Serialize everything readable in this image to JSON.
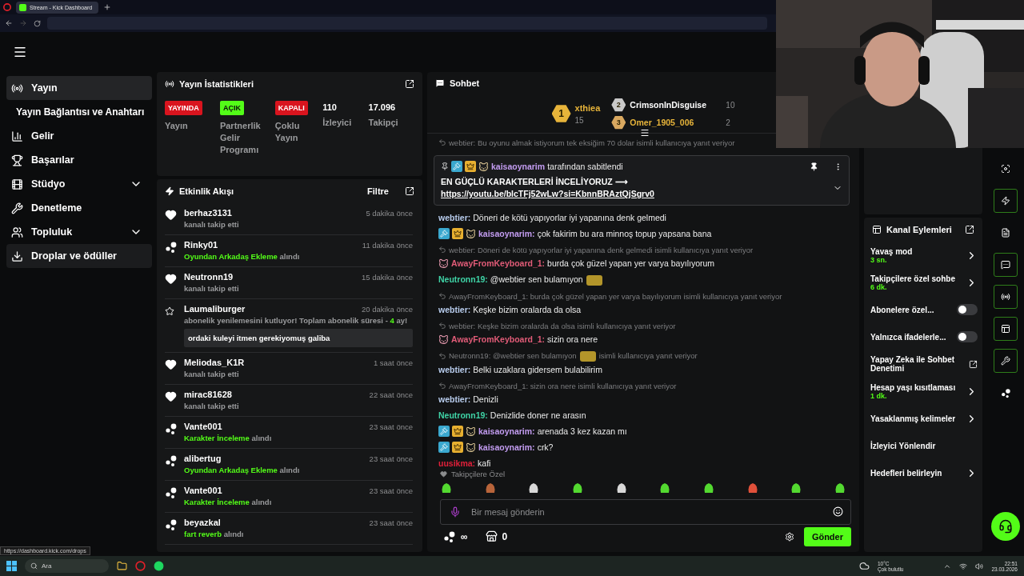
{
  "browser": {
    "tab_title": "Stream - Kick Dashboard",
    "status_url": "https://dashboard.kick.com/drops"
  },
  "sidebar": {
    "items": [
      {
        "label": "Yayın",
        "selected": true,
        "hovered": false,
        "expandable": false
      },
      {
        "label": "Yayın Bağlantısı ve Anahtarı",
        "selected": false,
        "hovered": false,
        "expandable": false
      },
      {
        "label": "Gelir",
        "selected": false,
        "hovered": false,
        "expandable": false
      },
      {
        "label": "Başarılar",
        "selected": false,
        "hovered": false,
        "expandable": false
      },
      {
        "label": "Stüdyo",
        "selected": false,
        "hovered": false,
        "expandable": true
      },
      {
        "label": "Denetleme",
        "selected": false,
        "hovered": false,
        "expandable": false
      },
      {
        "label": "Topluluk",
        "selected": false,
        "hovered": false,
        "expandable": true
      },
      {
        "label": "Droplar ve ödüller",
        "selected": false,
        "hovered": true,
        "expandable": false
      }
    ]
  },
  "stats": {
    "title": "Yayın İstatistikleri",
    "statuses": [
      {
        "badge": "YAYINDA",
        "label": "Yayın",
        "color": "#d9141e"
      },
      {
        "badge": "AÇIK",
        "label": "Partnerlik Gelir Programı",
        "color": "#53fc18"
      },
      {
        "badge": "KAPALI",
        "label": "Çoklu Yayın",
        "color": "#d9141e"
      }
    ],
    "counters": [
      {
        "value": "110",
        "label": "İzleyici"
      },
      {
        "value": "17.096",
        "label": "Takipçi"
      }
    ]
  },
  "activity": {
    "title": "Etkinlik Akışı",
    "filter": "Filtre",
    "items": [
      {
        "kind": "follow",
        "user": "berhaz3131",
        "time": "5 dakika önce",
        "action": "kanalı takip etti"
      },
      {
        "kind": "reward",
        "user": "Rinky01",
        "time": "11 dakika önce",
        "reward": "Oyundan Arkadaş Ekleme",
        "action": "alındı"
      },
      {
        "kind": "follow",
        "user": "Neutronn19",
        "time": "15 dakika önce",
        "action": "kanalı takip etti"
      },
      {
        "kind": "subscription",
        "user": "Laumaliburger",
        "time": "20 dakika önce",
        "action": "abonelik yenilemesini kutluyor! Toplam abonelik süresi -",
        "months": "4",
        "unit": "ay!",
        "quote": "ordaki kuleyi itmen gerekiyomuş galiba"
      },
      {
        "kind": "follow",
        "user": "Meliodas_K1R",
        "time": "1 saat önce",
        "action": "kanalı takip etti"
      },
      {
        "kind": "follow",
        "user": "mirac81628",
        "time": "22 saat önce",
        "action": "kanalı takip etti"
      },
      {
        "kind": "reward",
        "user": "Vante001",
        "time": "23 saat önce",
        "reward": "Karakter İnceleme",
        "action": "alındı"
      },
      {
        "kind": "reward",
        "user": "alibertug",
        "time": "23 saat önce",
        "reward": "Oyundan Arkadaş Ekleme",
        "action": "alındı"
      },
      {
        "kind": "reward",
        "user": "Vante001",
        "time": "23 saat önce",
        "reward": "Karakter İnceleme",
        "action": "alındı"
      },
      {
        "kind": "reward",
        "user": "beyazkal",
        "time": "23 saat önce",
        "reward": "fart reverb",
        "action": "alındı"
      }
    ]
  },
  "chat": {
    "title": "Sohbet",
    "leaderboard": [
      {
        "rank": "1",
        "user": "xthiea",
        "count": "15",
        "color": "#e7b43a"
      },
      {
        "rank": "2",
        "user": "CrimsonInDisguise",
        "count": "10",
        "color": "#ffffff"
      },
      {
        "rank": "3",
        "user": "Omer_1905_006",
        "count": "2",
        "color": "#e7b43a"
      }
    ],
    "messages_above_pin": [
      {
        "reply": "webtier: Bu oyunu almak istiyorum tek eksiğim 70 dolar isimli kullanıcıya yanıt veriyor"
      }
    ],
    "pinned": {
      "badges": [
        {
          "kind": "moderator"
        },
        {
          "kind": "crown"
        },
        {
          "kind": "subscriber"
        }
      ],
      "user": "kaisaoynarim",
      "by": "tarafından sabitlendi",
      "text": "EN GÜÇLÜ KARAKTERLERİ İNCELİYORUZ ⟶",
      "link": "https://youtu.be/blcTFj52wLw?si=KbnnBRAztQjSgrv0"
    },
    "messages": [
      {
        "user": "webtier:",
        "color": "#b9cdee",
        "text": "Döneri de kötü yapıyorlar iyi yapanına denk gelmedi"
      },
      {
        "user": "kaisaoynarim:",
        "color": "#c49df2",
        "badges": [
          {
            "kind": "moderator"
          },
          {
            "kind": "crown"
          },
          {
            "kind": "subscriber"
          }
        ],
        "text": "çok fakirim bu ara minnoş topup yapsana bana"
      },
      {
        "reply": "webtier: Döneri de kötü yapıyorlar iyi yapanına denk gelmedi isimli kullanıcıya yanıt veriyor",
        "user": "AwayFromKeyboard_1:",
        "color": "#e25c78",
        "badges": [
          {
            "kind": "pet"
          }
        ],
        "text": "burda çok güzel yapan yer varya bayılıyorum"
      },
      {
        "user": "Neutronn19:",
        "color": "#3fd3a6",
        "text": "@webtier sen bulamıyon",
        "emote": true
      },
      {
        "reply": "AwayFromKeyboard_1: burda çok güzel yapan yer varya bayılıyorum isimli kullanıcıya yanıt veriyor",
        "user": "webtier:",
        "color": "#b9cdee",
        "text": "Keşke bizim oralarda da olsa"
      },
      {
        "reply": "webtier: Keşke bizim oralarda da olsa isimli kullanıcıya yanıt veriyor",
        "user": "AwayFromKeyboard_1:",
        "color": "#e25c78",
        "badges": [
          {
            "kind": "pet"
          }
        ],
        "text": "sizin ora nere"
      },
      {
        "reply": "Neutronn19: @webtier sen bulamıyon",
        "reply_emote": true,
        "reply_after": "isimli kullanıcıya yanıt veriyor",
        "user": "webtier:",
        "color": "#b9cdee",
        "text": "Belki uzaklara gidersem bulabilirim"
      },
      {
        "reply": "AwayFromKeyboard_1: sizin ora nere isimli kullanıcıya yanıt veriyor",
        "user": "webtier:",
        "color": "#b9cdee",
        "text": "Denizli"
      },
      {
        "user": "Neutronn19:",
        "color": "#3fd3a6",
        "text": "Denizlide doner ne arasın"
      },
      {
        "user": "kaisaoynarim:",
        "color": "#c49df2",
        "badges": [
          {
            "kind": "moderator"
          },
          {
            "kind": "crown"
          },
          {
            "kind": "subscriber"
          }
        ],
        "text": "arenada 3 kez kazan mı"
      },
      {
        "user": "kaisaoynarim:",
        "color": "#c49df2",
        "badges": [
          {
            "kind": "moderator"
          },
          {
            "kind": "crown"
          },
          {
            "kind": "subscriber"
          }
        ],
        "text": "crk?"
      },
      {
        "user": "uusikma:",
        "color": "#e0203a",
        "text": "kafi"
      }
    ],
    "emote_section": "Takipçilere Özel",
    "placeholder": "Bir mesaj gönderin",
    "points": "∞",
    "store_count": "0",
    "send": "Gönder"
  },
  "channel_actions": {
    "title": "Kanal Eylemleri",
    "items": [
      {
        "kind": "nav",
        "label": "Yavaş mod",
        "value": "3 sn."
      },
      {
        "kind": "nav",
        "label": "Takipçilere özel sohbe",
        "value": "6 dk."
      },
      {
        "kind": "toggle",
        "label": "Abonelere özel...",
        "on": false
      },
      {
        "kind": "toggle",
        "label": "Yalnızca ifadelerle...",
        "on": false
      },
      {
        "kind": "external",
        "label": "Yapay Zeka ile Sohbet Denetimi"
      },
      {
        "kind": "nav",
        "label": "Hesap yaşı kısıtlaması",
        "value": "1 dk."
      },
      {
        "kind": "nav",
        "label": "Yasaklanmış kelimeler"
      },
      {
        "kind": "plain",
        "label": "İzleyici Yönlendir"
      },
      {
        "kind": "nav",
        "label": "Hedefleri belirleyin"
      }
    ]
  },
  "tool_rail": [
    {
      "active": false
    },
    {
      "active": true
    },
    {
      "active": false
    },
    {
      "active": true
    },
    {
      "active": true
    },
    {
      "active": true
    },
    {
      "active": true
    },
    {
      "active": false
    }
  ],
  "taskbar": {
    "search": "Ara",
    "temperature": "10°C",
    "weather": "Çok bulutlu",
    "time": "22:51",
    "date": "23.03.2026"
  }
}
